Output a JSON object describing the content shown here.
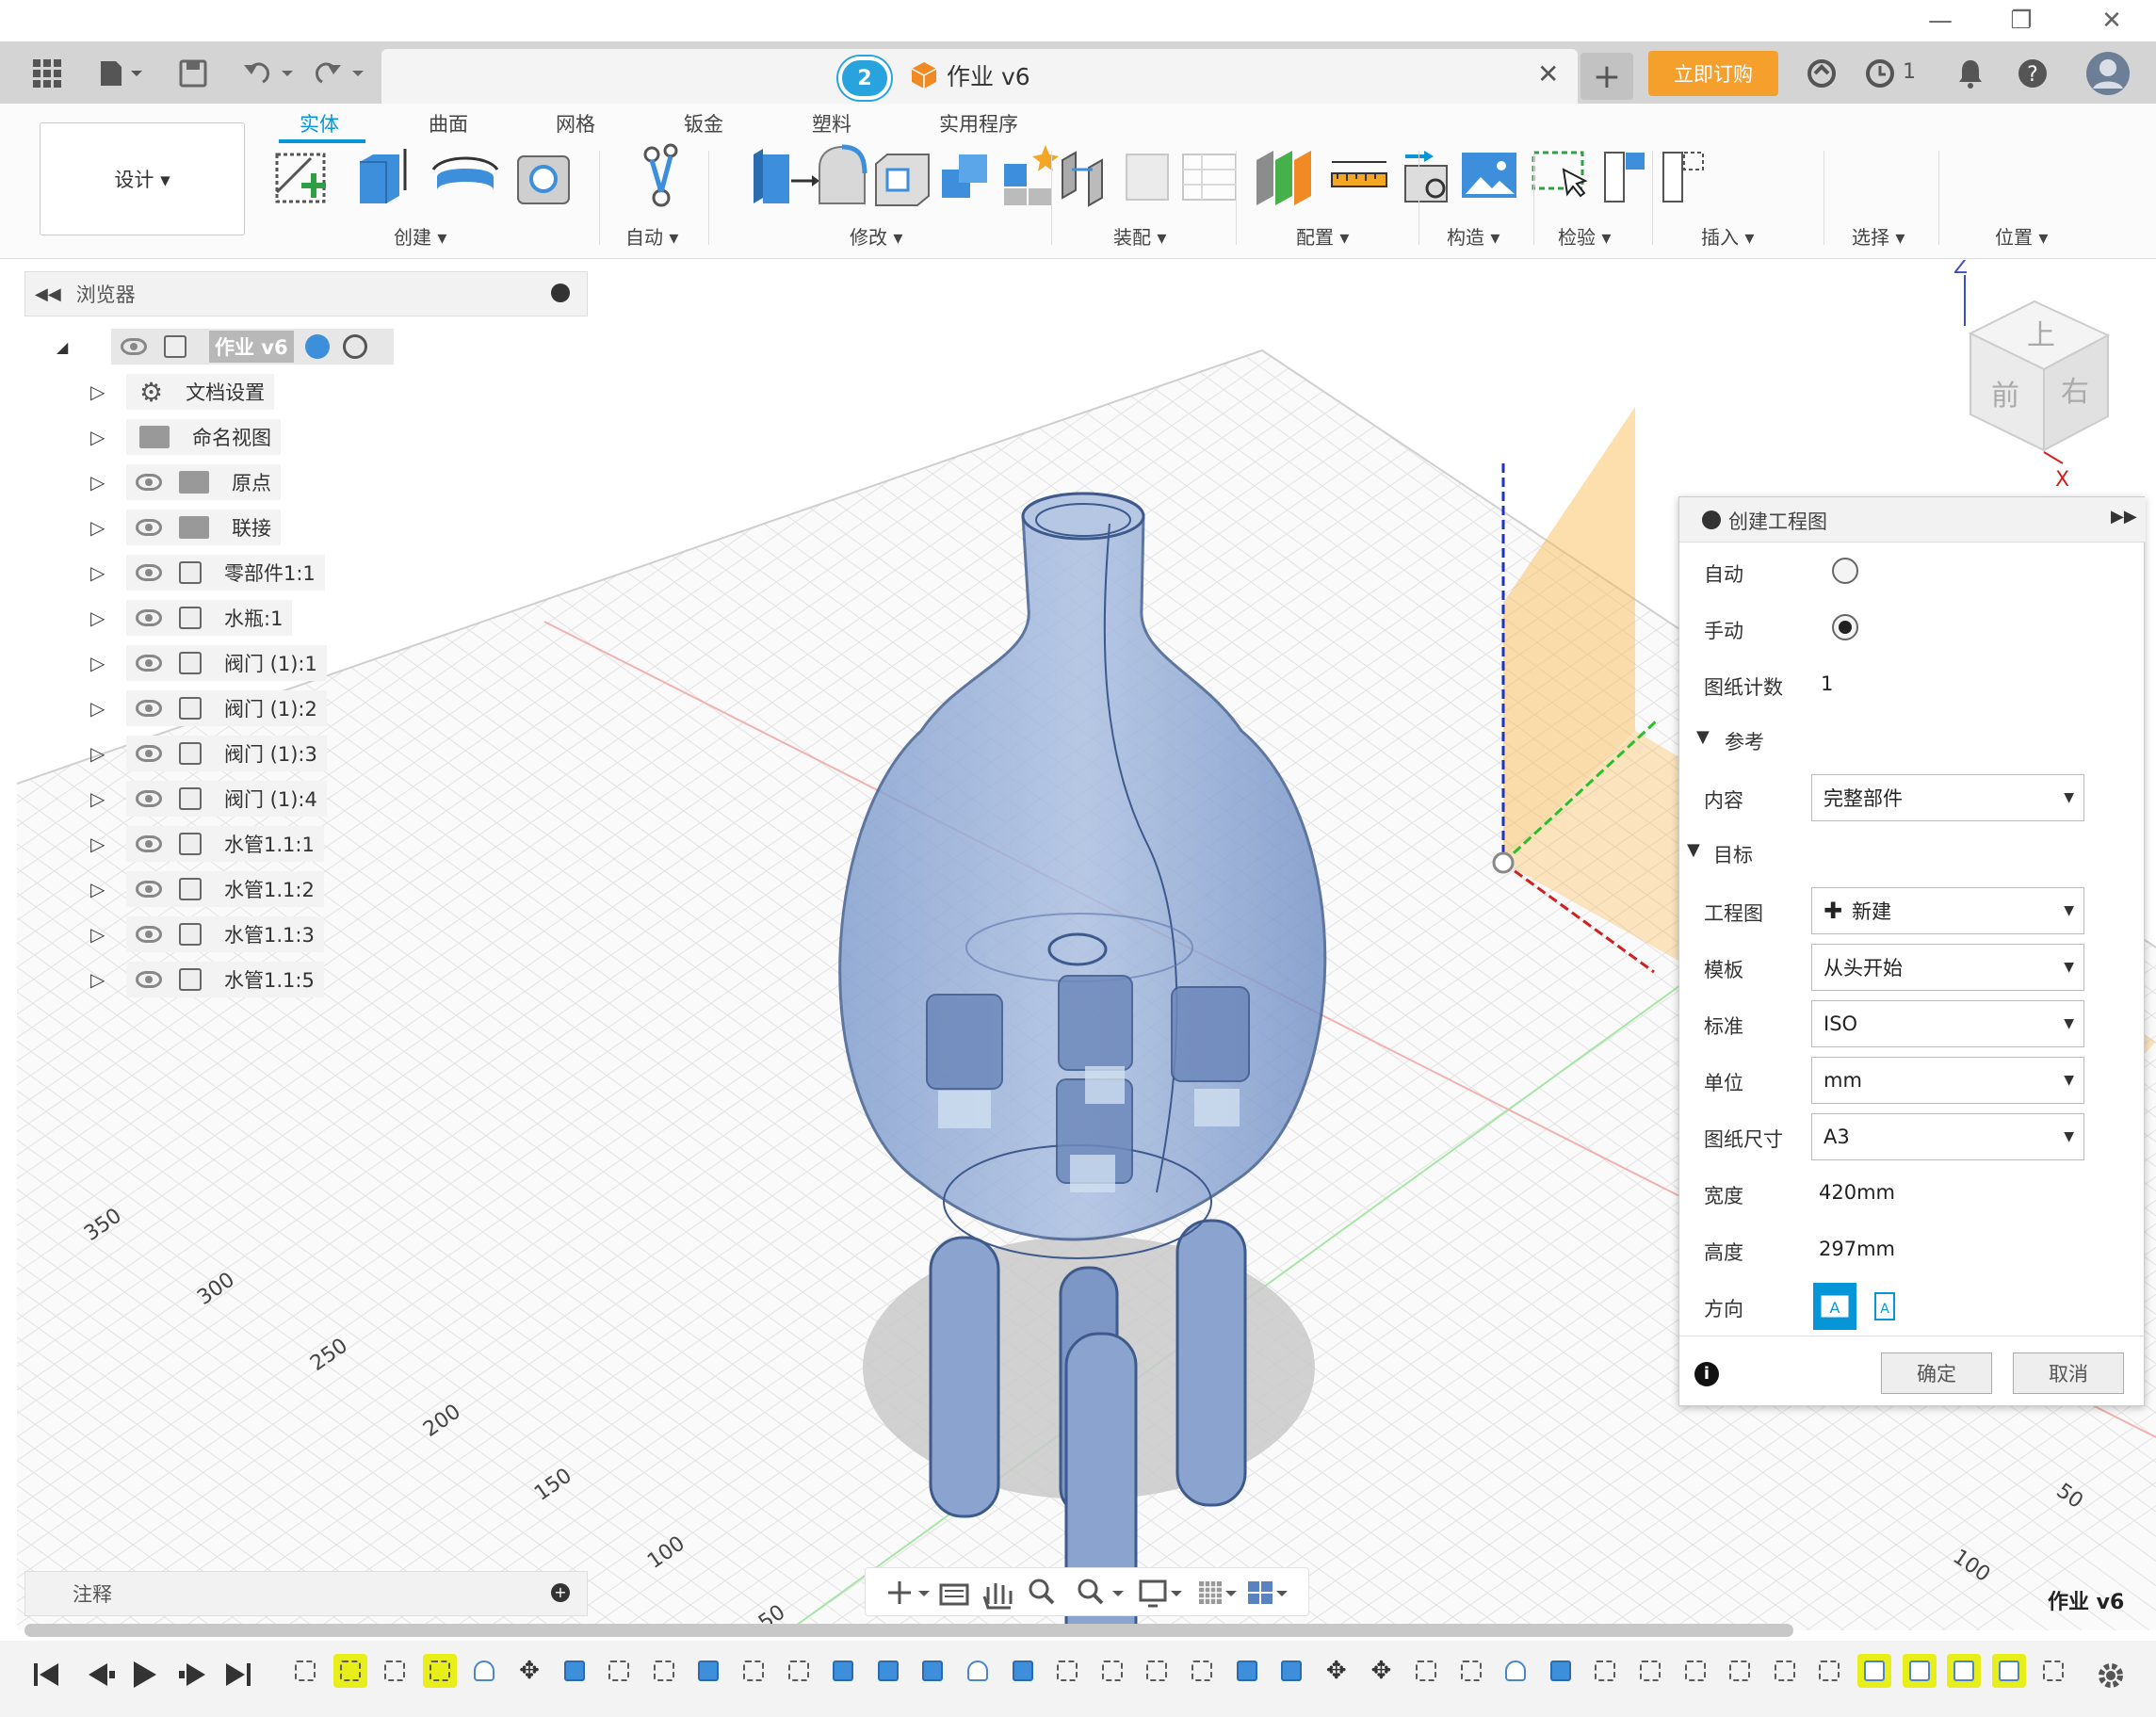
{
  "window": {
    "minimize": "—",
    "restore": "❐",
    "close": "✕"
  },
  "tabbar": {
    "job_count": "2",
    "doc_title": "作业 v6",
    "close": "✕",
    "new_tab": "+",
    "subscribe": "立即订购",
    "jobs_count": "1"
  },
  "ribbon": {
    "design_label": "设计 ▾",
    "tabs": [
      "实体",
      "曲面",
      "网格",
      "钣金",
      "塑料",
      "实用程序"
    ],
    "groups": [
      "创建 ▾",
      "自动 ▾",
      "修改 ▾",
      "装配 ▾",
      "配置 ▾",
      "构造 ▾",
      "检验 ▾",
      "插入 ▾",
      "选择 ▾",
      "位置 ▾"
    ]
  },
  "browser": {
    "title": "浏览器",
    "root": "作业 v6",
    "items": [
      {
        "label": "文档设置",
        "icon": "gear-icon",
        "eye": false
      },
      {
        "label": "命名视图",
        "icon": "folder-icon",
        "eye": false
      },
      {
        "label": "原点",
        "icon": "folder-icon",
        "eye": true
      },
      {
        "label": "联接",
        "icon": "folder-icon",
        "eye": true
      },
      {
        "label": "零部件1:1",
        "icon": "component-icon",
        "eye": true
      },
      {
        "label": "水瓶:1",
        "icon": "body-icon",
        "eye": true
      },
      {
        "label": "阀门 (1):1",
        "icon": "body-icon",
        "eye": true
      },
      {
        "label": "阀门 (1):2",
        "icon": "body-icon",
        "eye": true
      },
      {
        "label": "阀门 (1):3",
        "icon": "body-icon",
        "eye": true
      },
      {
        "label": "阀门 (1):4",
        "icon": "body-icon",
        "eye": true
      },
      {
        "label": "水管1.1:1",
        "icon": "component-icon",
        "eye": true
      },
      {
        "label": "水管1.1:2",
        "icon": "component-icon",
        "eye": true
      },
      {
        "label": "水管1.1:3",
        "icon": "component-icon",
        "eye": true
      },
      {
        "label": "水管1.1:5",
        "icon": "component-icon",
        "eye": true
      }
    ]
  },
  "viewcube": {
    "top": "上",
    "front": "前",
    "right": "右",
    "axis_z": "Z",
    "axis_x": "X"
  },
  "grid_labels": {
    "left": [
      "350",
      "300",
      "250",
      "200",
      "150",
      "100",
      "50"
    ],
    "right": [
      "50",
      "100"
    ]
  },
  "dialog": {
    "title": "创建工程图",
    "auto_label": "自动",
    "manual_label": "手动",
    "sheet_count_label": "图纸计数",
    "sheet_count": "1",
    "reference_section": "参考",
    "content_label": "内容",
    "content_value": "完整部件",
    "target_section": "目标",
    "drawing_label": "工程图",
    "drawing_value": "新建",
    "template_label": "模板",
    "template_value": "从头开始",
    "standard_label": "标准",
    "standard_value": "ISO",
    "unit_label": "单位",
    "unit_value": "mm",
    "sheet_size_label": "图纸尺寸",
    "sheet_size_value": "A3",
    "width_label": "宽度",
    "width_value": "420mm",
    "height_label": "高度",
    "height_value": "297mm",
    "orientation_label": "方向",
    "ok": "确定",
    "cancel": "取消"
  },
  "notes": {
    "title": "注释"
  },
  "watermark": "作业 v6",
  "colors": {
    "accent": "#0696d7",
    "subscribe": "#f59f2d",
    "highlight": "#e8ee1a",
    "model": "#6f8fc4"
  }
}
